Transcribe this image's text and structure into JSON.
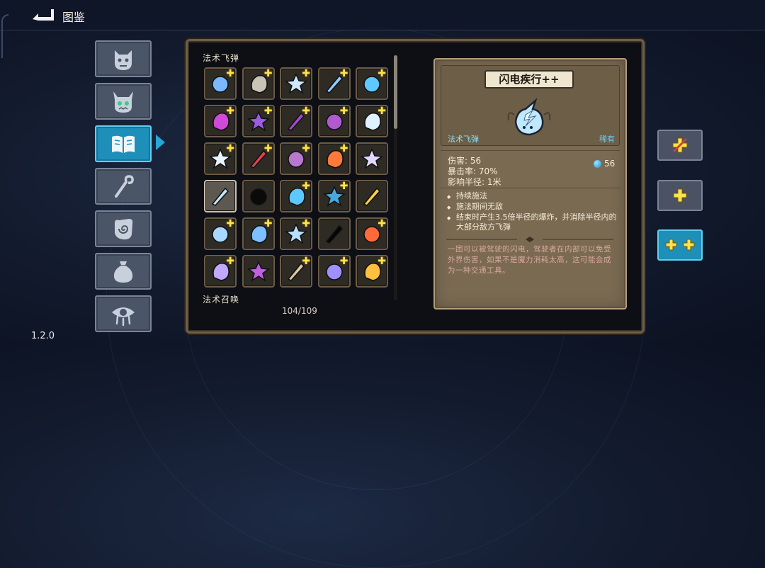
{
  "header": {
    "title": "图鉴"
  },
  "version": "1.2.0",
  "categories": [
    {
      "name": "monsters",
      "icon": "demon-face-icon",
      "active": false
    },
    {
      "name": "bosses",
      "icon": "horned-skull-icon",
      "active": false
    },
    {
      "name": "spells",
      "icon": "open-book-icon",
      "active": true
    },
    {
      "name": "staffs",
      "icon": "staff-icon",
      "active": false
    },
    {
      "name": "relics",
      "icon": "hand-spiral-icon",
      "active": false
    },
    {
      "name": "items",
      "icon": "pouch-icon",
      "active": false
    },
    {
      "name": "curses",
      "icon": "eye-drip-icon",
      "active": false
    }
  ],
  "collection": {
    "section_title": "法术飞弹",
    "next_section_title": "法术召唤",
    "count": "104/109",
    "cells": [
      {
        "icon": "blue-orb-icon",
        "plus": true,
        "color": "#7ab8ff"
      },
      {
        "icon": "stone-icon",
        "plus": true,
        "color": "#c8c3b6"
      },
      {
        "icon": "butterfly-icon",
        "plus": true,
        "color": "#cfe8ff"
      },
      {
        "icon": "arrow-bolt-icon",
        "plus": true,
        "color": "#8fd0ff"
      },
      {
        "icon": "spiral-square-icon",
        "plus": true,
        "color": "#5fc8ff"
      },
      {
        "icon": "purple-flame-icon",
        "plus": true,
        "color": "#d04ad8"
      },
      {
        "icon": "vortex-icon",
        "plus": true,
        "color": "#9a5ce0"
      },
      {
        "icon": "dark-orb-icon",
        "plus": true,
        "color": "#a24ad0"
      },
      {
        "icon": "crossed-bolts-icon",
        "plus": true,
        "color": "#b05ad0"
      },
      {
        "icon": "wolf-head-icon",
        "plus": true,
        "color": "#dff2ff"
      },
      {
        "icon": "ice-spear-icon",
        "plus": true,
        "color": "#e8f4ff"
      },
      {
        "icon": "red-blob-icon",
        "plus": true,
        "color": "#e04050"
      },
      {
        "icon": "crystal-rock-icon",
        "plus": true,
        "color": "#b878d0"
      },
      {
        "icon": "rainbow-icon",
        "plus": true,
        "color": "#ff7a3a"
      },
      {
        "icon": "sparkle-star-icon",
        "plus": false,
        "color": "#e0d8ff"
      },
      {
        "icon": "lightning-spirit-icon",
        "plus": false,
        "color": "#bfe8ff",
        "selected": true
      },
      {
        "icon": "shadow-beast-icon",
        "plus": false,
        "color": "#0a0a0a"
      },
      {
        "icon": "thunder-claws-icon",
        "plus": true,
        "color": "#5cc8ff"
      },
      {
        "icon": "water-wave-icon",
        "plus": true,
        "color": "#4aa8e0"
      },
      {
        "icon": "gold-rune-coin-icon",
        "plus": false,
        "color": "#ffd23a"
      },
      {
        "icon": "crescent-slash-icon",
        "plus": true,
        "color": "#a8d8ff"
      },
      {
        "icon": "twin-crescent-icon",
        "plus": true,
        "color": "#7cc0ff"
      },
      {
        "icon": "feather-lance-icon",
        "plus": true,
        "color": "#b8e0ff"
      },
      {
        "icon": "dark-silhouette-icon",
        "plus": false,
        "color": "#050505"
      },
      {
        "icon": "fire-burst-icon",
        "plus": true,
        "color": "#ff6a3a"
      },
      {
        "icon": "triple-arrow-icon",
        "plus": true,
        "color": "#c0a8ff"
      },
      {
        "icon": "hex-star-icon",
        "plus": false,
        "color": "#c060e0"
      },
      {
        "icon": "golden-arrow-icon",
        "plus": true,
        "color": "#d8c8a0"
      },
      {
        "icon": "meteor-icon",
        "plus": true,
        "color": "#a090ff"
      },
      {
        "icon": "golden-wings-icon",
        "plus": true,
        "color": "#ffc040"
      }
    ]
  },
  "detail": {
    "name": "闪电疾行++",
    "type": "法术飞弹",
    "rarity": "稀有",
    "stats": [
      "伤害: 56",
      "暴击率: 70%",
      "影响半径: 1米"
    ],
    "mana_cost": "56",
    "effects": [
      "持续施法",
      "施法期间无敌",
      "结束时产生3.5倍半径的爆炸，并消除半径内的大部分敌方飞弹"
    ],
    "flavor": "一团可以被驾驶的闪电，驾驶者在内部可以免受外界伤害，如果不是魔力消耗太高，这可能会成为一种交通工具。"
  },
  "upgrade_levels": [
    {
      "name": "base",
      "icon": "broken-plus-icon",
      "active": false
    },
    {
      "name": "plus",
      "icon": "plus-icon",
      "active": false
    },
    {
      "name": "plus-plus",
      "icon": "double-plus-icon",
      "active": true
    }
  ]
}
